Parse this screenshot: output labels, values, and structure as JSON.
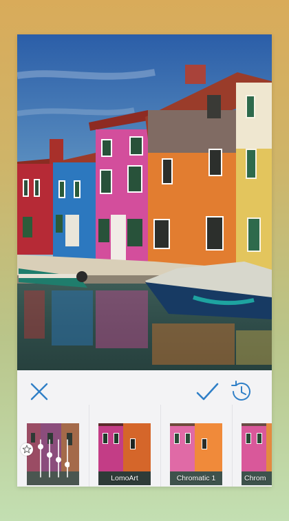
{
  "editor": {
    "cancel_icon": "x-icon",
    "apply_icon": "checkmark-icon",
    "history_icon": "clock-history-icon",
    "accent_color": "#2f7fc7"
  },
  "filters": [
    {
      "label": "",
      "icon": "sliders-icon",
      "badge_icon": "star-icon"
    },
    {
      "label": "LomoArt"
    },
    {
      "label": "Chromatic 1"
    },
    {
      "label": "Chrom"
    }
  ]
}
